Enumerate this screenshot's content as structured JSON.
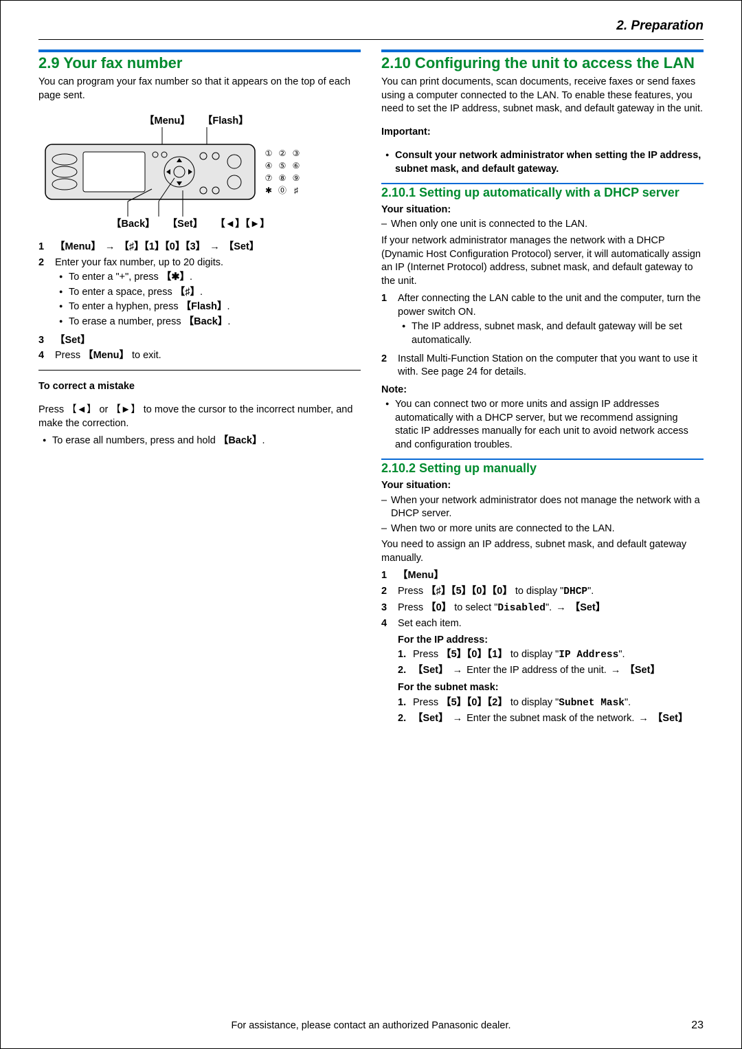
{
  "chapter": "2. Preparation",
  "left": {
    "heading": "2.9 Your fax number",
    "intro": "You can program your fax number so that it appears on the top of each page sent.",
    "label_menu": "Menu",
    "label_flash": "Flash",
    "label_back": "Back",
    "label_set": "Set",
    "label_arrows": "【◄】【►】",
    "step1_a": "Menu",
    "step1_b": "♯",
    "step1_c": "1",
    "step1_d": "0",
    "step1_e": "3",
    "step1_f": "Set",
    "step2": "Enter your fax number, up to 20 digits.",
    "step2_bullets": {
      "b1a": "To enter a \"+\", press ",
      "b1b": "✱",
      "b2a": "To enter a space, press ",
      "b2b": "♯",
      "b3a": "To enter a hyphen, press ",
      "b3b": "Flash",
      "b4a": "To erase a number, press ",
      "b4b": "Back"
    },
    "step3": "Set",
    "step4a": "Press ",
    "step4b": "Menu",
    "step4c": " to exit.",
    "mistake_h": "To correct a mistake",
    "mistake_p1": "Press 【◄】 or 【►】 to move the cursor to the incorrect number, and make the correction.",
    "mistake_b1a": "To erase all numbers, press and hold ",
    "mistake_b1b": "Back"
  },
  "right": {
    "heading": "2.10 Configuring the unit to access the LAN",
    "intro": "You can print documents, scan documents, receive faxes or send faxes using a computer connected to the LAN. To enable these features, you need to set the IP address, subnet mask, and default gateway in the unit.",
    "important_label": "Important:",
    "important_bullet": "Consult your network administrator when setting the IP address, subnet mask, and default gateway.",
    "sub1_h": "2.10.1 Setting up automatically with a DHCP server",
    "situation_label": "Your situation:",
    "sub1_sit": "When only one unit is connected to the LAN.",
    "sub1_p": "If your network administrator manages the network with a DHCP (Dynamic Host Configuration Protocol) server, it will automatically assign an IP (Internet Protocol) address, subnet mask, and default gateway to the unit.",
    "sub1_s1": "After connecting the LAN cable to the unit and the computer, turn the power switch ON.",
    "sub1_s1_b": "The IP address, subnet mask, and default gateway will be set automatically.",
    "sub1_s2": "Install Multi-Function Station on the computer that you want to use it with. See page 24 for details.",
    "note_label": "Note:",
    "sub1_note_b": "You can connect two or more units and assign IP addresses automatically with a DHCP server, but we recommend assigning static IP addresses manually for each unit to avoid network access and configuration troubles.",
    "sub2_h": "2.10.2 Setting up manually",
    "sub2_sit1": "When your network administrator does not manage the network with a DHCP server.",
    "sub2_sit2": "When two or more units are connected to the LAN.",
    "sub2_p": "You need to assign an IP address, subnet mask, and default gateway manually.",
    "sub2_s1": "Menu",
    "sub2_s2a": "Press ",
    "sub2_s2b": "♯",
    "sub2_s2c": "5",
    "sub2_s2d": "0",
    "sub2_s2e": "0",
    "sub2_s2f": " to display \"",
    "sub2_s2g": "DHCP",
    "sub2_s2h": "\".",
    "sub2_s3a": "Press ",
    "sub2_s3b": "0",
    "sub2_s3c": " to select \"",
    "sub2_s3d": "Disabled",
    "sub2_s3e": "\". ",
    "sub2_s3f": "Set",
    "sub2_s4": "Set each item.",
    "ip_h": "For the IP address:",
    "ip_1a": "Press ",
    "ip_1b": "5",
    "ip_1c": "0",
    "ip_1d": "1",
    "ip_1e": " to display \"",
    "ip_1f": "IP Address",
    "ip_1g": "\".",
    "ip_2a": "Set",
    "ip_2b": " Enter the IP address of the unit. ",
    "ip_2c": "Set",
    "sm_h": "For the subnet mask:",
    "sm_1a": "Press ",
    "sm_1b": "5",
    "sm_1c": "0",
    "sm_1d": "2",
    "sm_1e": " to display \"",
    "sm_1f": "Subnet Mask",
    "sm_1g": "\".",
    "sm_2a": "Set",
    "sm_2b": " Enter the subnet mask of the network. ",
    "sm_2c": "Set"
  },
  "footer": "For assistance, please contact an authorized Panasonic dealer.",
  "page_no": "23"
}
